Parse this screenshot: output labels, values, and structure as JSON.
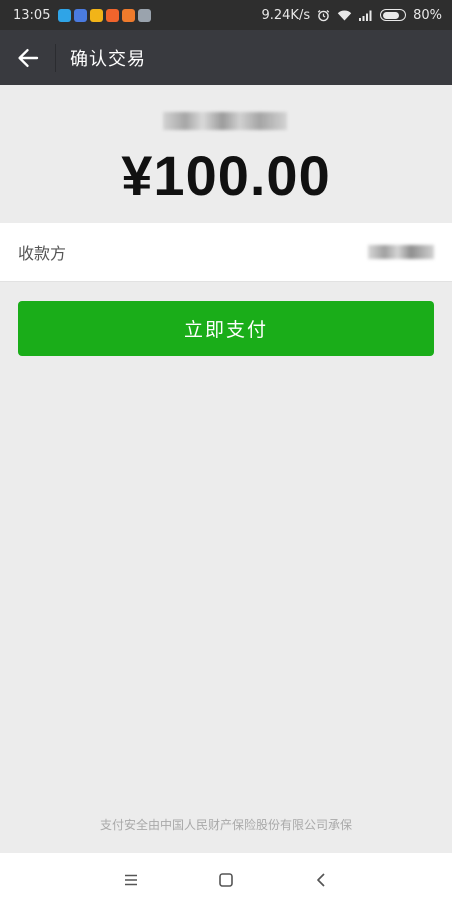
{
  "status_bar": {
    "time": "13:05",
    "network_speed": "9.24K/s",
    "battery": "80%",
    "battery_level": 0.8,
    "notification_icons": [
      {
        "name": "app-icon-blue",
        "color": "#2fa4e7"
      },
      {
        "name": "app-icon-blue2",
        "color": "#4a7be0"
      },
      {
        "name": "app-icon-yellow",
        "color": "#f2b418"
      },
      {
        "name": "app-icon-orange",
        "color": "#f0642c"
      },
      {
        "name": "app-icon-orange2",
        "color": "#ef7b2c"
      },
      {
        "name": "app-icon-gray",
        "color": "#9aa3ad"
      }
    ]
  },
  "header": {
    "title": "确认交易",
    "back_icon": "arrow-left-icon"
  },
  "transaction": {
    "amount": "¥100.00"
  },
  "payee": {
    "label": "收款方"
  },
  "pay_button": {
    "label": "立即支付",
    "color": "#1aad19"
  },
  "footer": {
    "note": "支付安全由中国人民财产保险股份有限公司承保"
  },
  "nav_bar": {
    "items": [
      "menu-icon",
      "home-icon",
      "back-icon"
    ]
  }
}
